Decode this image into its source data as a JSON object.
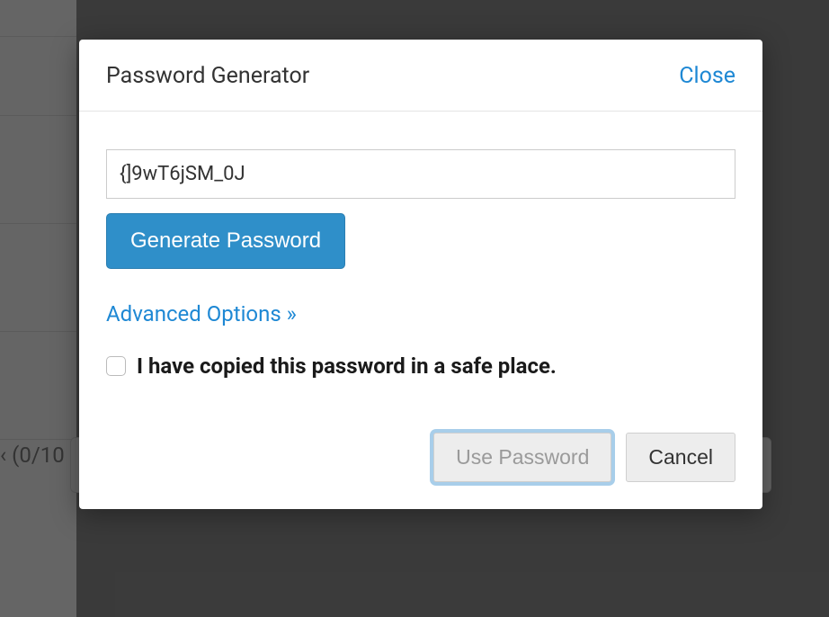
{
  "modal": {
    "title": "Password Generator",
    "close_label": "Close",
    "password_value": "{]9wT6jSM_0J",
    "generate_label": "Generate Password",
    "advanced_label": "Advanced Options »",
    "checkbox_label": "I have copied this password in a safe place.",
    "checkbox_checked": false,
    "use_password_label": "Use Password",
    "cancel_label": "Cancel"
  },
  "background": {
    "partial_text": "‹ (0/10"
  }
}
